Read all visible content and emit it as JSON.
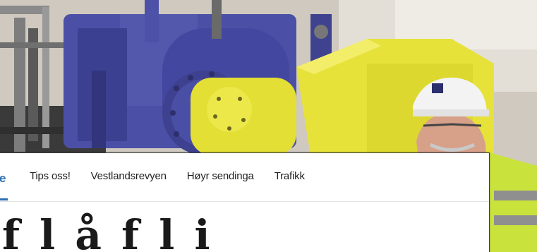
{
  "nav": {
    "brand_fragment": "e",
    "links": [
      {
        "label": "Tips oss!"
      },
      {
        "label": "Vestlandsrevyen"
      },
      {
        "label": "Høyr sendinga"
      },
      {
        "label": "Trafikk"
      }
    ]
  },
  "headline": {
    "partial_text": "f  l  å  f      l       i"
  },
  "colors": {
    "accent": "#2c6fb3",
    "machine_blue": "#4a4fa3",
    "machine_yellow": "#e6e23a"
  }
}
